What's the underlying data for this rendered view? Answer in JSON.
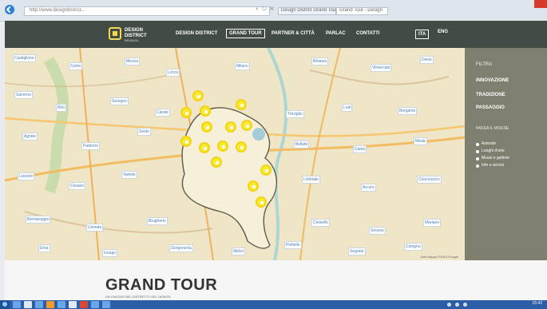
{
  "browser": {
    "address": "http://www.designdistrict...",
    "tabs": [
      "Design District Grand Tour",
      "Grand Tour - Design"
    ]
  },
  "site": {
    "brand_line1": "DESIGN",
    "brand_line2": "DISTRICT",
    "brand_sub": "BRIANZA",
    "menu": [
      "DESIGN DISTRICT",
      "GRAND TOUR",
      "PARTNER & CITTÀ",
      "PARLAC",
      "CONTATTI"
    ],
    "active_menu": "GRAND TOUR",
    "languages": [
      "ITA",
      "ENG"
    ],
    "active_language": "ITA"
  },
  "sidebar": {
    "title": "FILTRA",
    "links": [
      "INNOVAZIONE",
      "TRADIZIONE",
      "PASSAGGIO"
    ],
    "subtitle": "PASSA IL MOUSE",
    "legend": [
      "Aziende",
      "Luoghi d'arte",
      "Musei e gallerie",
      "Info e servizi"
    ]
  },
  "map": {
    "labels": [
      "Castiglione",
      "Como",
      "Monza",
      "Lecco",
      "Milano",
      "Brianza",
      "Vimercate",
      "Desio",
      "Saronno",
      "Rho",
      "Seregno",
      "Carate",
      "Treviglio",
      "Lodi",
      "Bergamo",
      "Agrate",
      "Paderno",
      "Sesto",
      "Bollate",
      "Cantù",
      "Meda",
      "Lissone",
      "Cesano",
      "Varedo",
      "Limbiate",
      "Arcore",
      "Concorezzo",
      "Bernareggio",
      "Usmate",
      "Brugherio",
      "Cinisello",
      "Seveso",
      "Mariano",
      "Erba",
      "Inzago",
      "Gorgonzola",
      "Melzo",
      "Pioltello",
      "Segrate",
      "Cologno",
      "Cernusco",
      "Vaprio",
      "Trezzo",
      "Capriate",
      "Dalmine",
      "Stezzano",
      "Verdello",
      "Caravaggio",
      "Rivolta",
      "Pandino",
      "Crema",
      "Bagnolo",
      "Castelleone",
      "Soresina",
      "Pizzighettone",
      "Codogno",
      "Casalpusterlengo",
      "Sant'Angelo",
      "Melegnano",
      "Binasco",
      "Pavia",
      "Abbiategrasso",
      "Magenta",
      "Legnano",
      "Busto",
      "Gallarate",
      "Varese",
      "Tradate",
      "Appiano",
      "Olgiate",
      "Lurate",
      "Fino",
      "Lomazzo",
      "Turate",
      "Cislago",
      "Ceriano",
      "Solaro",
      "Garbagnate",
      "Arese",
      "Lainate",
      "Nerviano",
      "Parabiago",
      "Canegrate",
      "San Vittore",
      "Cerro",
      "Pogliano",
      "Vanzago",
      "Pregnana",
      "Cornaredo",
      "Settimo",
      "Cusago",
      "Trezzano",
      "Corsico",
      "Buccinasco",
      "Assago",
      "Rozzano",
      "Opera",
      "Locate",
      "Pieve",
      "San Donato",
      "San Giuliano",
      "Peschiera",
      "Mediglia",
      "Pantigliate",
      "Paullo",
      "Tribiano",
      "Dresano",
      "Vizzolo",
      "Cerro al Lambro",
      "Carpiano",
      "Lacchiarella",
      "Vernate",
      "Motta",
      "Casorate",
      "Besate",
      "Morimondo",
      "Ozzero",
      "Robecco",
      "Boffalora",
      "Bernate",
      "Cuggiono",
      "Inveruno",
      "Arconate",
      "Buscate",
      "Castano",
      "Nosate",
      "Turbigo",
      "Robecchetto",
      "Magnago",
      "Vanzaghello",
      "Lonate",
      "Ferno",
      "Samarate",
      "Cardano",
      "Cassano"
    ],
    "footer": "Dati mappa ©2013 Google"
  },
  "page": {
    "title": "GRAND TOUR",
    "subtitle": "UN VIAGGIO NEL DISTRETTO DEL DESIGN"
  },
  "taskbar": {
    "time": "15:42"
  },
  "colors": {
    "nav": "#434b46",
    "sidebar": "#7f7f70",
    "marker": "#f7ea36",
    "taskbar": "#2c5ea7"
  }
}
